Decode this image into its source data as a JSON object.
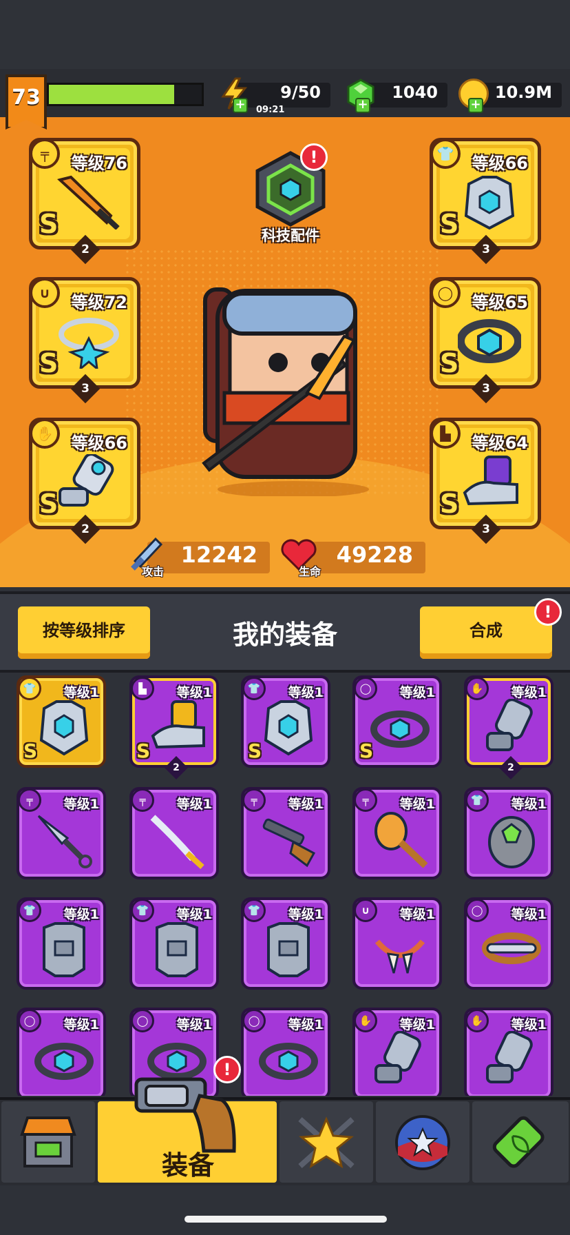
{
  "player": {
    "level": "73",
    "xp_fraction": 0.82
  },
  "resources": {
    "energy": {
      "value": "9/50",
      "timer": "09:21"
    },
    "gems": {
      "value": "1040"
    },
    "gold": {
      "value": "10.9M"
    }
  },
  "equipped": {
    "weapon": {
      "level": "等级76",
      "grade": "S",
      "stars": "2",
      "type_icon": "gun-icon"
    },
    "necklace": {
      "level": "等级72",
      "grade": "S",
      "stars": "3",
      "type_icon": "necklace-icon"
    },
    "gloves": {
      "level": "等级66",
      "grade": "S",
      "stars": "2",
      "type_icon": "glove-icon"
    },
    "armor": {
      "level": "等级66",
      "grade": "S",
      "stars": "3",
      "type_icon": "shirt-icon"
    },
    "belt": {
      "level": "等级65",
      "grade": "S",
      "stars": "3",
      "type_icon": "belt-icon"
    },
    "boots": {
      "level": "等级64",
      "grade": "S",
      "stars": "3",
      "type_icon": "boot-icon"
    }
  },
  "tech_parts": {
    "label": "科技配件",
    "alert": "!"
  },
  "stats": {
    "attack": {
      "label": "攻击",
      "value": "12242"
    },
    "health": {
      "label": "生命",
      "value": "49228"
    }
  },
  "inventory_header": {
    "sort_label": "按等级排序",
    "title": "我的装备",
    "merge_label": "合成",
    "merge_alert": "!"
  },
  "inventory": [
    {
      "level": "等级1",
      "grade": "S",
      "stars": "",
      "rarity": "gold",
      "kind": "armor"
    },
    {
      "level": "等级1",
      "grade": "S",
      "stars": "2",
      "rarity": "purple-gold",
      "kind": "boots"
    },
    {
      "level": "等级1",
      "grade": "S",
      "stars": "",
      "rarity": "purple",
      "kind": "armor"
    },
    {
      "level": "等级1",
      "grade": "S",
      "stars": "",
      "rarity": "purple",
      "kind": "belt"
    },
    {
      "level": "等级1",
      "grade": "",
      "stars": "2",
      "rarity": "purple-gold",
      "kind": "gloves"
    },
    {
      "level": "等级1",
      "grade": "",
      "stars": "",
      "rarity": "purple",
      "kind": "kunai"
    },
    {
      "level": "等级1",
      "grade": "",
      "stars": "",
      "rarity": "purple",
      "kind": "katana"
    },
    {
      "level": "等级1",
      "grade": "",
      "stars": "",
      "rarity": "purple",
      "kind": "shotgun"
    },
    {
      "level": "等级1",
      "grade": "",
      "stars": "",
      "rarity": "purple",
      "kind": "bat"
    },
    {
      "level": "等级1",
      "grade": "",
      "stars": "",
      "rarity": "purple",
      "kind": "armor-green"
    },
    {
      "level": "等级1",
      "grade": "",
      "stars": "",
      "rarity": "purple",
      "kind": "vest"
    },
    {
      "level": "等级1",
      "grade": "",
      "stars": "",
      "rarity": "purple",
      "kind": "vest"
    },
    {
      "level": "等级1",
      "grade": "",
      "stars": "",
      "rarity": "purple",
      "kind": "vest"
    },
    {
      "level": "等级1",
      "grade": "",
      "stars": "",
      "rarity": "purple",
      "kind": "fang-necklace"
    },
    {
      "level": "等级1",
      "grade": "",
      "stars": "",
      "rarity": "purple",
      "kind": "bone-belt"
    },
    {
      "level": "等级1",
      "grade": "",
      "stars": "",
      "rarity": "purple",
      "kind": "belt"
    },
    {
      "level": "等级1",
      "grade": "",
      "stars": "",
      "rarity": "purple",
      "kind": "belt"
    },
    {
      "level": "等级1",
      "grade": "",
      "stars": "",
      "rarity": "purple",
      "kind": "belt"
    },
    {
      "level": "等级1",
      "grade": "",
      "stars": "",
      "rarity": "purple",
      "kind": "gloves"
    },
    {
      "level": "等级1",
      "grade": "",
      "stars": "",
      "rarity": "purple",
      "kind": "gloves"
    }
  ],
  "nav": {
    "active_label": "装备",
    "alert": "!"
  },
  "colors": {
    "accent": "#ffcf33",
    "hero_bg": "#f08a1f",
    "epic": "#a437d8",
    "legendary": "#f1b71c",
    "xp": "#9de03f"
  }
}
